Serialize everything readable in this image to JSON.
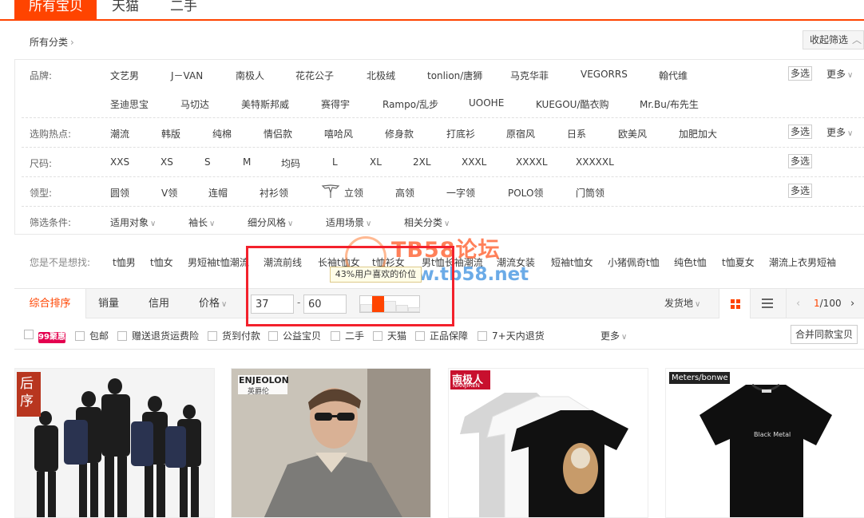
{
  "tabs": [
    "所有宝贝",
    "天猫",
    "二手"
  ],
  "category": {
    "path": "所有分类",
    "collapse": "收起筛选"
  },
  "filters": {
    "brand": {
      "label": "品牌:",
      "items_row1": [
        "文艺男",
        "J－VAN",
        "南极人",
        "花花公子",
        "北极绒",
        "tonlion/唐狮",
        "马克华菲",
        "VEGORRS",
        "翰代维"
      ],
      "items_row2": [
        "圣迪思宝",
        "马切达",
        "美特斯邦威",
        "赛得宇",
        "Rampo/乱步",
        "UOOHE",
        "KUEGOU/酷衣购",
        "Mr.Bu/布先生"
      ],
      "multi": "多选",
      "more": "更多"
    },
    "hot": {
      "label": "选购热点:",
      "items": [
        "潮流",
        "韩版",
        "纯棉",
        "情侣款",
        "嘻哈风",
        "修身款",
        "打底衫",
        "原宿风",
        "日系",
        "欧美风",
        "加肥加大"
      ],
      "multi": "多选",
      "more": "更多"
    },
    "size": {
      "label": "尺码:",
      "items": [
        "XXS",
        "XS",
        "S",
        "M",
        "均码",
        "L",
        "XL",
        "2XL",
        "XXXL",
        "XXXXL",
        "XXXXXL"
      ],
      "multi": "多选"
    },
    "collar": {
      "label": "领型:",
      "items": [
        "圆领",
        "V领",
        "连帽",
        "衬衫领",
        "立领",
        "高领",
        "一字领",
        "POLO领",
        "门筒领"
      ],
      "multi": "多选"
    },
    "conditions": {
      "label": "筛选条件:",
      "items": [
        "适用对象",
        "袖长",
        "细分风格",
        "适用场景",
        "相关分类"
      ]
    }
  },
  "suggestions": {
    "label": "您是不是想找:",
    "items": [
      "t恤男",
      "t恤女",
      "男短袖t恤潮流",
      "潮流前线",
      "长袖t恤女",
      "t恤衫女",
      "男t恤长袖潮流",
      "潮流女装",
      "短袖t恤女",
      "小猪佩奇t恤",
      "纯色t恤",
      "t恤夏女",
      "潮流上衣男短袖"
    ]
  },
  "sort": {
    "items": [
      "综合排序",
      "销量",
      "信用",
      "价格"
    ],
    "price_min": "37",
    "price_max": "60",
    "dash": "-",
    "price_tip": "43%用户喜欢的价位",
    "price_histogram": [
      0.5,
      1.0,
      0.7,
      0.45,
      0.3
    ],
    "ship_from": "发货地",
    "page_current": "1",
    "page_total": "/100"
  },
  "services": {
    "badge": "99",
    "badge_suffix": "聚惠",
    "items": [
      "包邮",
      "赠送退货运费险",
      "货到付款",
      "公益宝贝",
      "二手",
      "天猫",
      "正品保障",
      "7+天内退货"
    ],
    "more": "更多",
    "merge": "合并同款宝贝"
  },
  "products": [
    {
      "brand": "后序"
    },
    {
      "brand": "ENJEOLON",
      "brand_sub": "英爵伦"
    },
    {
      "brand": "南极人",
      "brand_sub": "NANJIREN"
    },
    {
      "brand": "Meters/bonwe",
      "shirt_text": "Black Metal"
    }
  ],
  "watermark": {
    "title": "TB58论坛",
    "url": "www.tb58.net"
  },
  "colors": {
    "accent": "#ff4400",
    "highlight_box": "#f3212c"
  }
}
